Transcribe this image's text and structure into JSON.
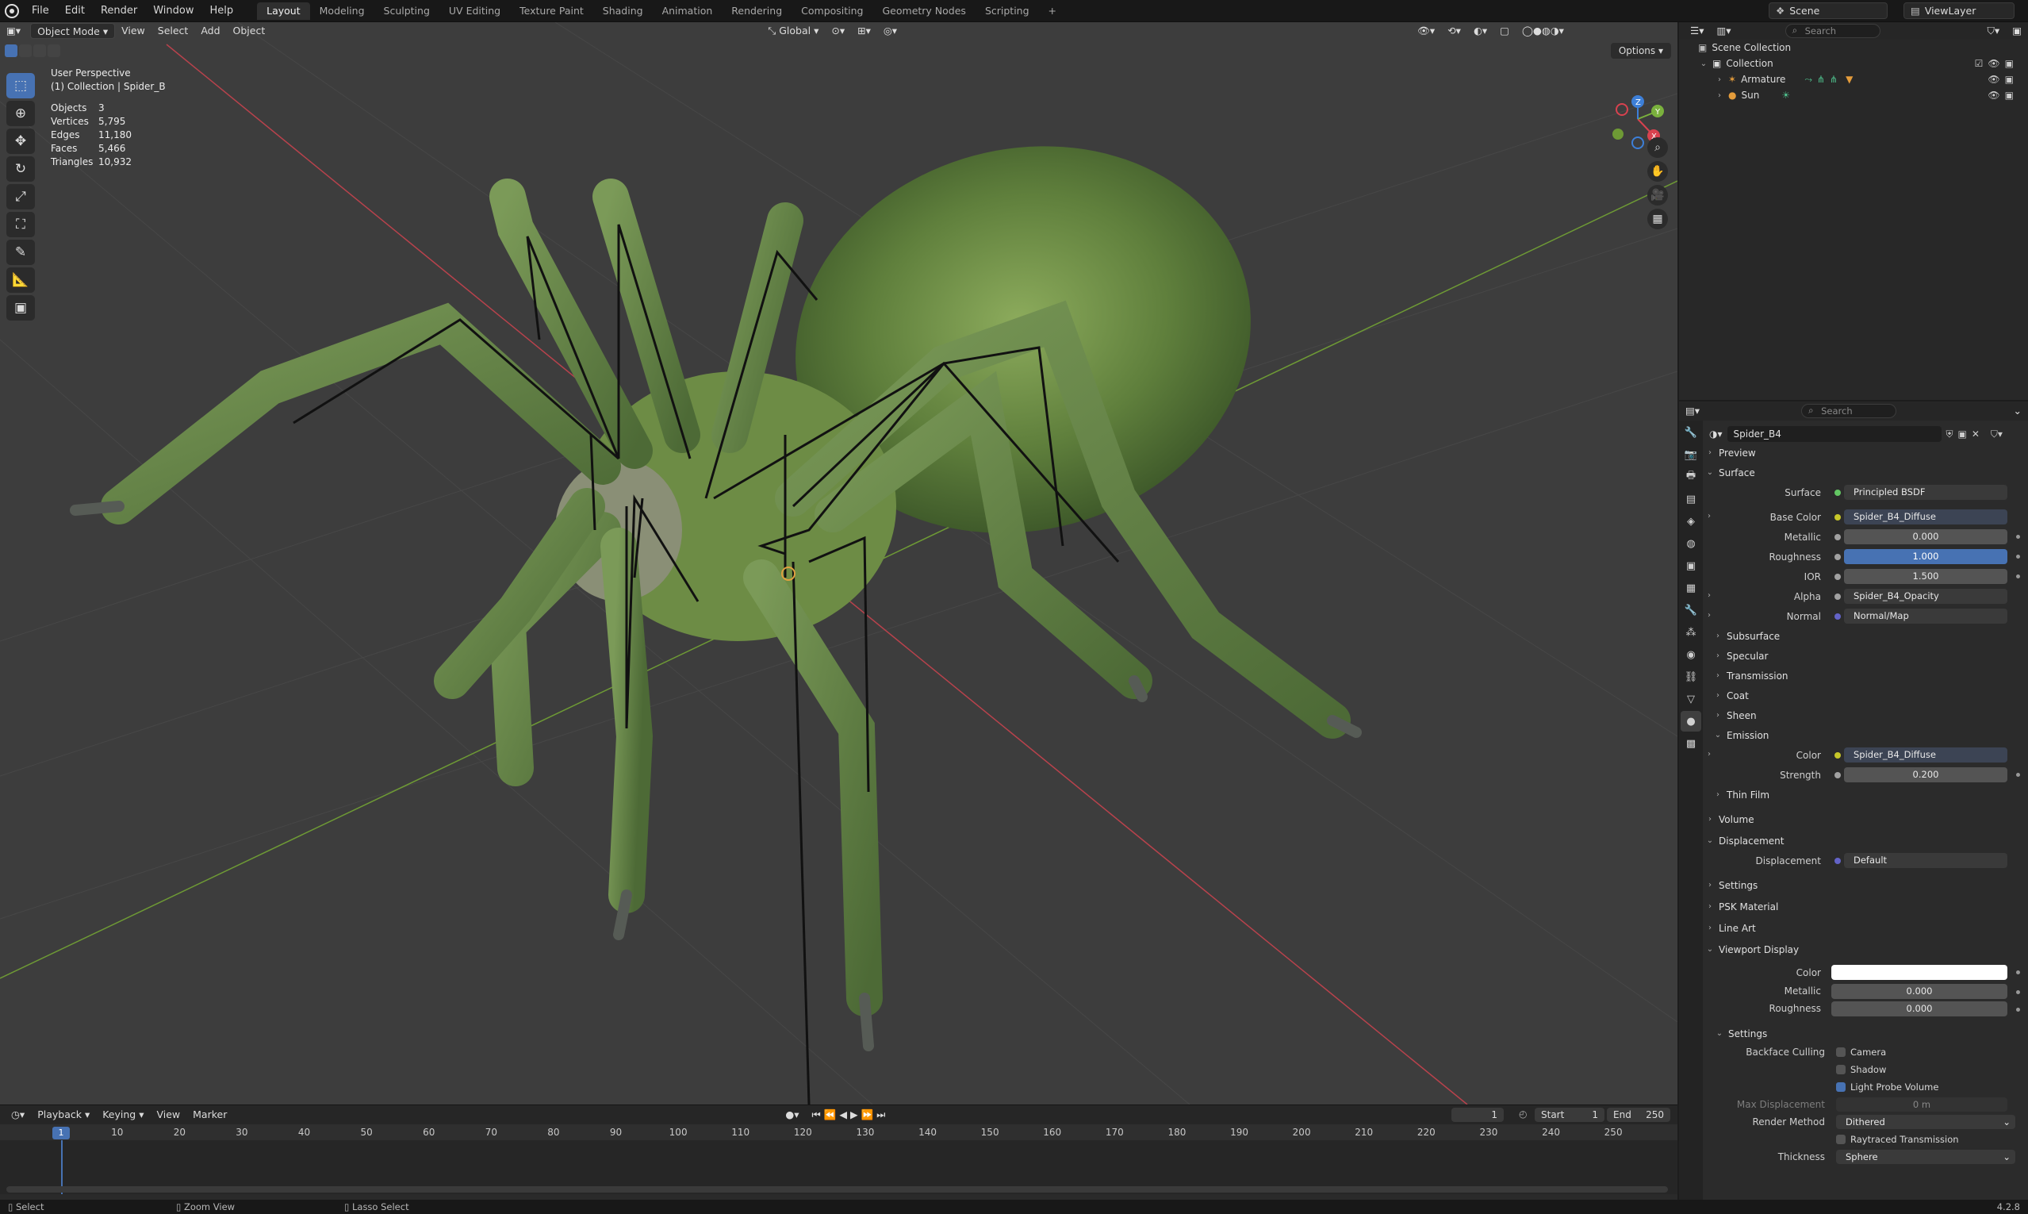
{
  "menu": [
    "File",
    "Edit",
    "Render",
    "Window",
    "Help"
  ],
  "workspaces": [
    "Layout",
    "Modeling",
    "Sculpting",
    "UV Editing",
    "Texture Paint",
    "Shading",
    "Animation",
    "Rendering",
    "Compositing",
    "Geometry Nodes",
    "Scripting"
  ],
  "scene_name": "Scene",
  "view_layer": "ViewLayer",
  "viewport": {
    "mode": "Object Mode",
    "menus": [
      "View",
      "Select",
      "Add",
      "Object"
    ],
    "orientation": "Global",
    "options": "Options",
    "perspective": "User Perspective",
    "collection_info": "(1) Collection | Spider_B",
    "stats": [
      {
        "label": "Objects",
        "value": "3"
      },
      {
        "label": "Vertices",
        "value": "5,795"
      },
      {
        "label": "Edges",
        "value": "11,180"
      },
      {
        "label": "Faces",
        "value": "5,466"
      },
      {
        "label": "Triangles",
        "value": "10,932"
      }
    ],
    "gizmo_axes": [
      "X",
      "Y",
      "Z"
    ]
  },
  "timeline": {
    "menus": [
      "Playback",
      "Keying",
      "View",
      "Marker"
    ],
    "current_frame": "1",
    "start_label": "Start",
    "start": "1",
    "end_label": "End",
    "end": "250",
    "ticks": [
      "10",
      "20",
      "30",
      "40",
      "50",
      "60",
      "70",
      "80",
      "90",
      "100",
      "110",
      "120",
      "130",
      "140",
      "150",
      "160",
      "170",
      "180",
      "190",
      "200",
      "210",
      "220",
      "230",
      "240",
      "250"
    ]
  },
  "status": {
    "select": "Select",
    "zoom": "Zoom View",
    "lasso": "Lasso Select",
    "version": "4.2.8"
  },
  "outliner": {
    "search_placeholder": "Search",
    "scene_collection": "Scene Collection",
    "collection": "Collection",
    "items": [
      "Armature",
      "Sun"
    ]
  },
  "properties": {
    "search_placeholder": "Search",
    "material": "Spider_B4",
    "panels": {
      "preview": "Preview",
      "surface": "Surface",
      "subsurface": "Subsurface",
      "specular": "Specular",
      "transmission": "Transmission",
      "coat": "Coat",
      "sheen": "Sheen",
      "emission": "Emission",
      "thin_film": "Thin Film",
      "volume": "Volume",
      "displacement": "Displacement",
      "settings": "Settings",
      "psk": "PSK Material",
      "line_art": "Line Art",
      "viewport_display": "Viewport Display",
      "vd_settings": "Settings"
    },
    "surface": {
      "surface_label": "Surface",
      "surface_value": "Principled BSDF",
      "base_color_label": "Base Color",
      "base_color_value": "Spider_B4_Diffuse",
      "metallic_label": "Metallic",
      "metallic_value": "0.000",
      "roughness_label": "Roughness",
      "roughness_value": "1.000",
      "ior_label": "IOR",
      "ior_value": "1.500",
      "alpha_label": "Alpha",
      "alpha_value": "Spider_B4_Opacity",
      "normal_label": "Normal",
      "normal_value": "Normal/Map"
    },
    "emission": {
      "color_label": "Color",
      "color_value": "Spider_B4_Diffuse",
      "strength_label": "Strength",
      "strength_value": "0.200"
    },
    "displacement": {
      "label": "Displacement",
      "value": "Default"
    },
    "viewport_display": {
      "color_label": "Color",
      "color_value": "#ffffff",
      "metallic_label": "Metallic",
      "metallic_value": "0.000",
      "roughness_label": "Roughness",
      "roughness_value": "0.000"
    },
    "vd_settings": {
      "backface_label": "Backface Culling",
      "camera": "Camera",
      "shadow": "Shadow",
      "light_probe": "Light Probe Volume",
      "max_disp_label": "Max Displacement",
      "max_disp_value": "0 m",
      "render_method_label": "Render Method",
      "render_method_value": "Dithered",
      "raytraced": "Raytraced Transmission",
      "thickness_label": "Thickness",
      "thickness_value": "Sphere"
    }
  },
  "colors": {
    "accent": "#4772b3",
    "spider_green": "#6e8f47",
    "axis_x": "#d8424f",
    "axis_y": "#7ab13d",
    "axis_z": "#3d7fd8"
  }
}
